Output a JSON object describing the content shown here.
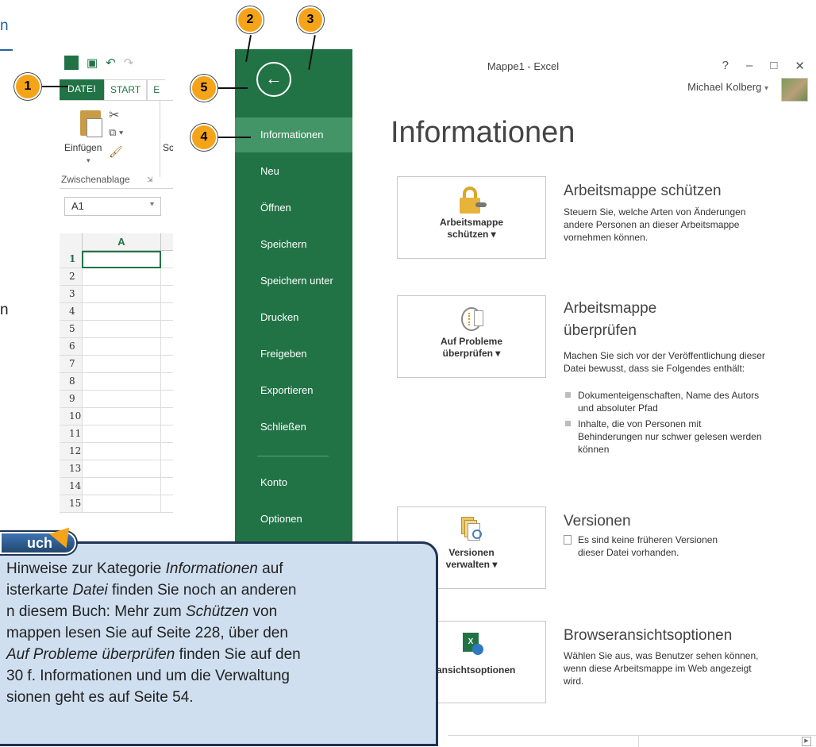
{
  "left_page": {
    "link_fragment": "n",
    "text_fragment": "n"
  },
  "excel": {
    "file_tab": "DATEI",
    "start_tab": "START",
    "next_tab": "E",
    "paste_label": "Einfügen",
    "cut_label": "Sc",
    "clipboard_group": "Zwischenablage",
    "namebox_value": "A1",
    "col_a": "A",
    "rows": [
      "1",
      "2",
      "3",
      "4",
      "5",
      "6",
      "7",
      "8",
      "9",
      "10",
      "11",
      "12",
      "13",
      "14",
      "15"
    ]
  },
  "backstage": {
    "back_icon": "back-arrow-icon",
    "items": [
      "Informationen",
      "Neu",
      "Öffnen",
      "Speichern",
      "Speichern unter",
      "Drucken",
      "Freigeben",
      "Exportieren",
      "Schließen",
      "Konto",
      "Optionen"
    ]
  },
  "window": {
    "title": "Mappe1 - Excel",
    "help": "?",
    "minimize": "–",
    "restore": "□",
    "close": "✕",
    "user": "Michael Kolberg",
    "user_caret": "▾"
  },
  "info": {
    "heading": "Informationen",
    "protect": {
      "card_label_1": "Arbeitsmappe",
      "card_label_2": "schützen ▾",
      "title": "Arbeitsmappe schützen",
      "text": "Steuern Sie, welche Arten von Änderungen andere Personen an dieser Arbeitsmappe vornehmen können."
    },
    "inspect": {
      "card_label_1": "Auf Probleme",
      "card_label_2": "überprüfen ▾",
      "title_1": "Arbeitsmappe",
      "title_2": "überprüfen",
      "text": "Machen Sie sich vor der Veröffentlichung dieser Datei bewusst, dass sie Folgendes enthält:",
      "bullets": [
        "Dokumenteigenschaften, Name des Autors und absoluter Pfad",
        "Inhalte, die von Personen mit Behinderungen nur schwer gelesen werden können"
      ]
    },
    "versions": {
      "card_label_1": "Versionen",
      "card_label_2": "verwalten ▾",
      "title": "Versionen",
      "text": "Es sind keine früheren Versionen dieser Datei vorhanden."
    },
    "browser": {
      "card_label": "eransichtsoptionen",
      "title": "Browseransichtsoptionen",
      "text": "Wählen Sie aus, was Benutzer sehen können, wenn diese Arbeitsmappe im Web angezeigt wird."
    }
  },
  "callouts": [
    "1",
    "2",
    "3",
    "4",
    "5"
  ],
  "note": {
    "badge": "uch",
    "text": "Hinweise zur Kategorie Informationen auf isterkarte Datei finden Sie noch an anderen n diesem Buch: Mehr zum Schützen von mappen lesen Sie auf Seite 228, über den Auf Probleme überprüfen finden Sie auf den 30 f. Informationen und um die Verwaltung sionen geht es auf Seite 54."
  },
  "colors": {
    "excel_green": "#217346",
    "backstage_active": "#439467",
    "callout": "#f5a419",
    "note_bg": "#cfdff0"
  }
}
